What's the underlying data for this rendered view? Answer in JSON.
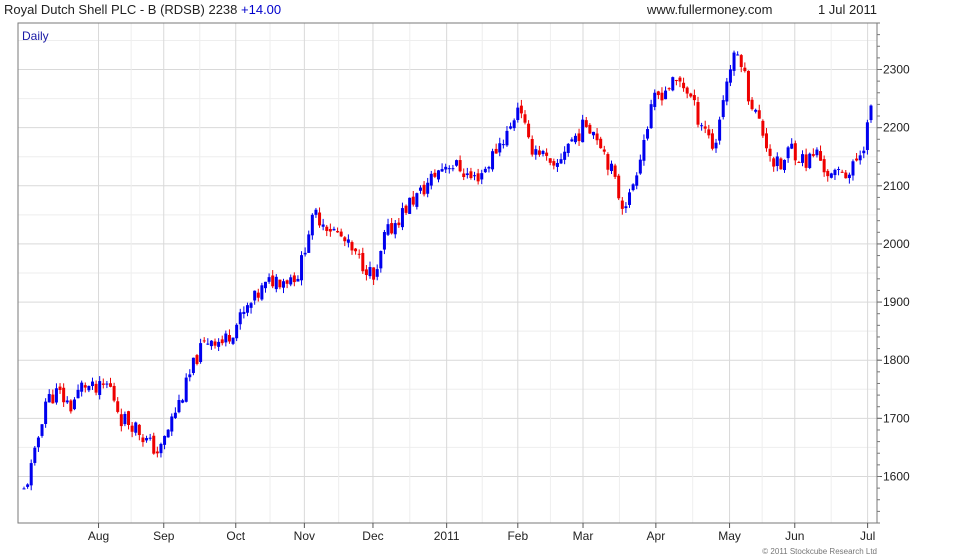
{
  "header": {
    "title": "Royal Dutch Shell PLC - B (RDSB)",
    "price": "2238",
    "change": "+14.00",
    "website": "www.fullermoney.com",
    "date": "1 Jul 2011"
  },
  "footer": {
    "copyright": "© 2011 Stockcube Research Ltd"
  },
  "colors": {
    "up": "#0000ee",
    "down": "#ee0000",
    "grid": "#d9d9d9",
    "change": "#0000cc"
  },
  "chart_data": {
    "type": "candlestick",
    "label": "Daily",
    "ylim": [
      1520,
      2380
    ],
    "yticks": [
      1600,
      1700,
      1800,
      1900,
      2000,
      2100,
      2200,
      2300
    ],
    "y_axis_position": "right",
    "grid": true,
    "xticks": [
      {
        "label": "Aug",
        "t": 0.088
      },
      {
        "label": "Sep",
        "t": 0.165
      },
      {
        "label": "Oct",
        "t": 0.25
      },
      {
        "label": "Nov",
        "t": 0.331
      },
      {
        "label": "Dec",
        "t": 0.412
      },
      {
        "label": "2011",
        "t": 0.499
      },
      {
        "label": "Feb",
        "t": 0.583
      },
      {
        "label": "Mar",
        "t": 0.66
      },
      {
        "label": "Apr",
        "t": 0.746
      },
      {
        "label": "May",
        "t": 0.833
      },
      {
        "label": "Jun",
        "t": 0.91
      },
      {
        "label": "Jul",
        "t": 0.996
      }
    ],
    "close_anchors": [
      [
        0.0,
        1575
      ],
      [
        0.012,
        1630
      ],
      [
        0.025,
        1730
      ],
      [
        0.04,
        1745
      ],
      [
        0.055,
        1720
      ],
      [
        0.07,
        1760
      ],
      [
        0.085,
        1745
      ],
      [
        0.1,
        1760
      ],
      [
        0.115,
        1700
      ],
      [
        0.13,
        1690
      ],
      [
        0.145,
        1660
      ],
      [
        0.16,
        1640
      ],
      [
        0.175,
        1700
      ],
      [
        0.19,
        1750
      ],
      [
        0.205,
        1810
      ],
      [
        0.22,
        1840
      ],
      [
        0.235,
        1830
      ],
      [
        0.25,
        1860
      ],
      [
        0.265,
        1890
      ],
      [
        0.28,
        1920
      ],
      [
        0.295,
        1940
      ],
      [
        0.31,
        1940
      ],
      [
        0.325,
        1950
      ],
      [
        0.335,
        2020
      ],
      [
        0.345,
        2050
      ],
      [
        0.36,
        2030
      ],
      [
        0.375,
        2010
      ],
      [
        0.39,
        1980
      ],
      [
        0.405,
        1960
      ],
      [
        0.415,
        1930
      ],
      [
        0.425,
        2010
      ],
      [
        0.44,
        2040
      ],
      [
        0.455,
        2070
      ],
      [
        0.47,
        2090
      ],
      [
        0.485,
        2120
      ],
      [
        0.5,
        2140
      ],
      [
        0.515,
        2130
      ],
      [
        0.53,
        2110
      ],
      [
        0.545,
        2130
      ],
      [
        0.56,
        2170
      ],
      [
        0.575,
        2200
      ],
      [
        0.585,
        2250
      ],
      [
        0.595,
        2170
      ],
      [
        0.61,
        2160
      ],
      [
        0.625,
        2120
      ],
      [
        0.64,
        2170
      ],
      [
        0.655,
        2190
      ],
      [
        0.665,
        2210
      ],
      [
        0.68,
        2180
      ],
      [
        0.695,
        2120
      ],
      [
        0.705,
        2070
      ],
      [
        0.715,
        2080
      ],
      [
        0.73,
        2170
      ],
      [
        0.745,
        2250
      ],
      [
        0.76,
        2270
      ],
      [
        0.775,
        2280
      ],
      [
        0.785,
        2260
      ],
      [
        0.795,
        2220
      ],
      [
        0.805,
        2200
      ],
      [
        0.815,
        2160
      ],
      [
        0.825,
        2250
      ],
      [
        0.835,
        2310
      ],
      [
        0.845,
        2330
      ],
      [
        0.855,
        2260
      ],
      [
        0.865,
        2220
      ],
      [
        0.875,
        2180
      ],
      [
        0.885,
        2140
      ],
      [
        0.895,
        2130
      ],
      [
        0.905,
        2170
      ],
      [
        0.915,
        2150
      ],
      [
        0.925,
        2140
      ],
      [
        0.935,
        2160
      ],
      [
        0.945,
        2130
      ],
      [
        0.955,
        2110
      ],
      [
        0.965,
        2130
      ],
      [
        0.975,
        2120
      ],
      [
        0.985,
        2150
      ],
      [
        0.993,
        2180
      ],
      [
        1.0,
        2238
      ]
    ]
  }
}
